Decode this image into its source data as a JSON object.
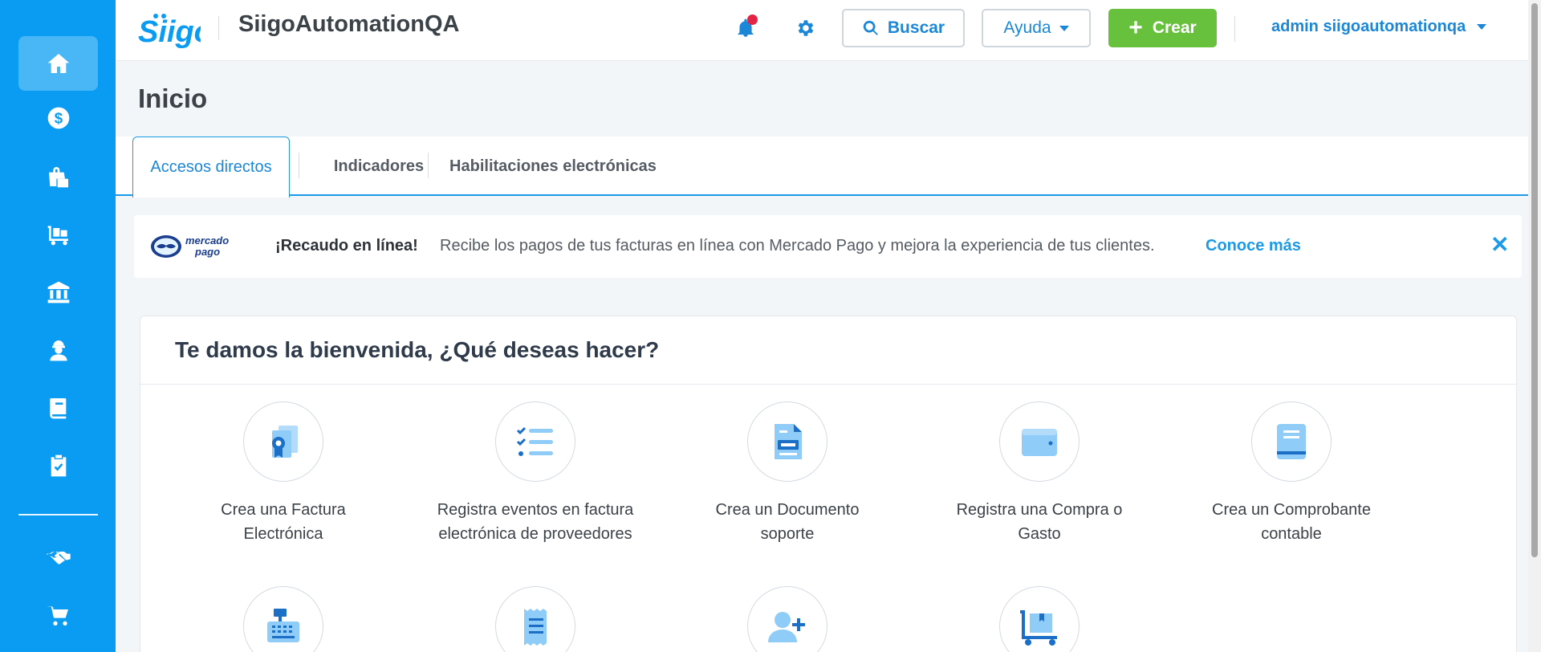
{
  "header": {
    "company": "SiigoAutomationQA",
    "search_label": "Buscar",
    "help_label": "Ayuda",
    "create_label": "Crear",
    "user_label": "admin siigoautomationqa"
  },
  "page": {
    "title": "Inicio"
  },
  "tabs": [
    {
      "label": "Accesos directos"
    },
    {
      "label": "Indicadores"
    },
    {
      "label": "Habilitaciones electrónicas"
    }
  ],
  "banner": {
    "title": "¡Recaudo en línea!",
    "text": "Recibe los pagos de tus facturas en línea con Mercado Pago y mejora la experiencia de tus clientes.",
    "link": "Conoce más",
    "close": "✕"
  },
  "welcome": {
    "title": "Te damos la bienvenida, ¿Qué deseas hacer?",
    "actions": [
      {
        "line1": "Crea una Factura",
        "line2": "Electrónica"
      },
      {
        "line1": "Registra eventos en factura",
        "line2": "electrónica de proveedores"
      },
      {
        "line1": "Crea un Documento",
        "line2": "soporte"
      },
      {
        "line1": "Registra una Compra o",
        "line2": "Gasto"
      },
      {
        "line1": "Crea un Comprobante",
        "line2": "contable"
      }
    ]
  },
  "icons": {
    "sidebar": [
      "home-icon",
      "dollar-icon",
      "shopping-bag-icon",
      "inventory-cart-icon",
      "bank-icon",
      "employee-icon",
      "book-icon",
      "clipboard-check-icon",
      "handshake-icon",
      "shopping-cart-icon"
    ],
    "accent": "#0a9bf2",
    "green": "#68c13c"
  }
}
